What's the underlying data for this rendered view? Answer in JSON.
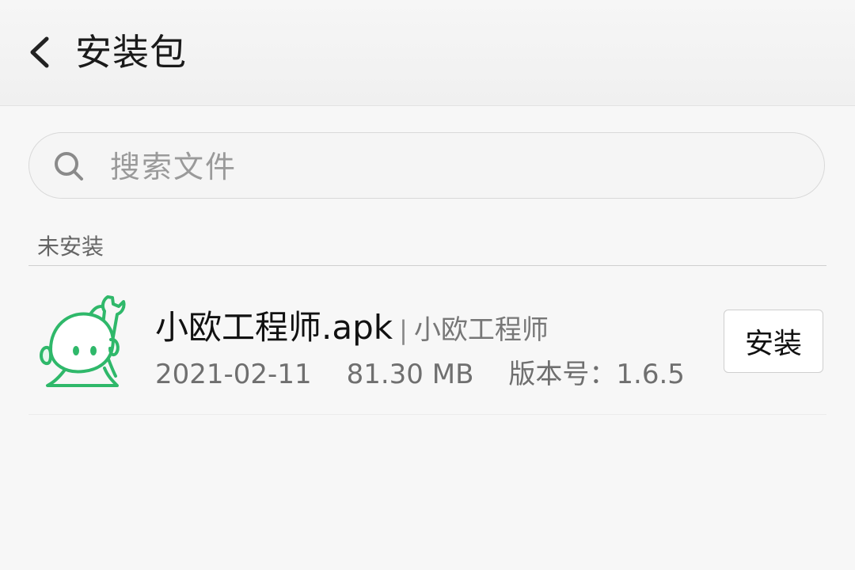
{
  "header": {
    "title": "安装包",
    "back_icon": "chevron-left-icon"
  },
  "search": {
    "placeholder": "搜索文件",
    "value": "",
    "icon": "search-icon"
  },
  "section": {
    "label": "未安装"
  },
  "apps": [
    {
      "file_name": "小欧工程师.apk",
      "separator": "|",
      "publisher": "小欧工程师",
      "date": "2021-02-11",
      "size": "81.30 MB",
      "version": "版本号：1.6.5",
      "action_label": "安装",
      "icon": "robot-wrench-app-icon",
      "icon_color": "#2fb86a"
    }
  ]
}
